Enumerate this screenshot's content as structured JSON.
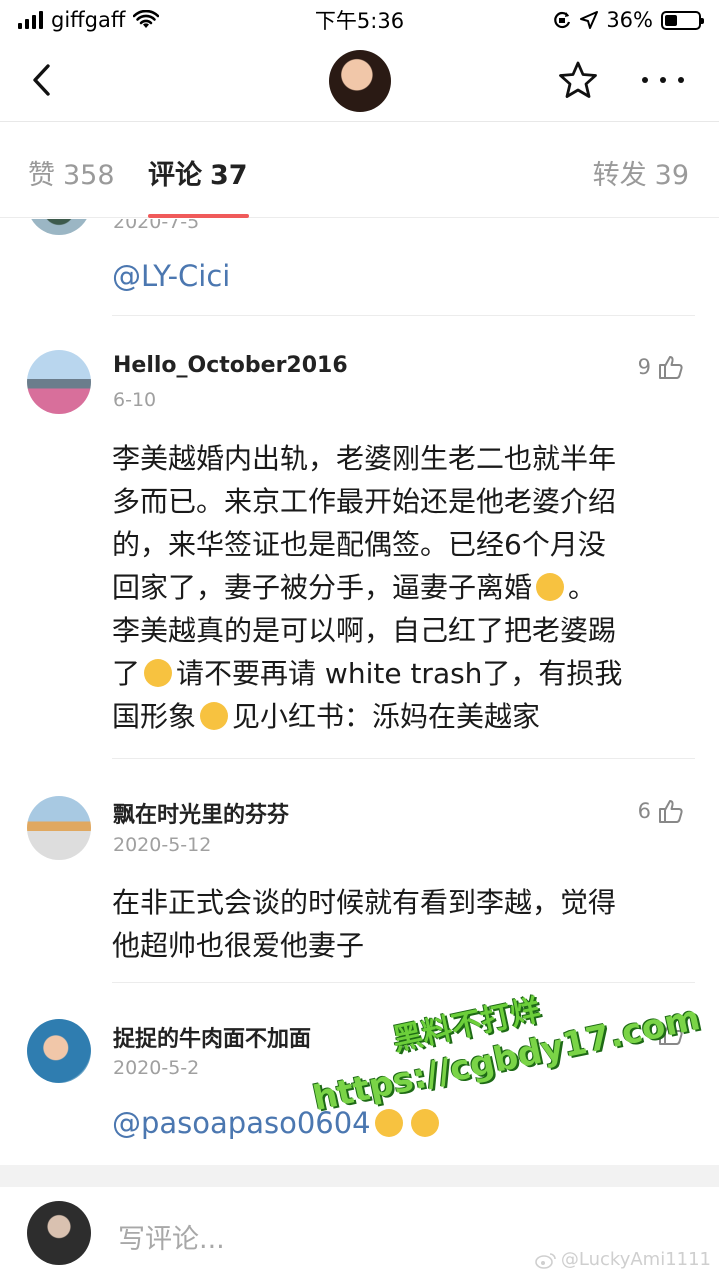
{
  "status_bar": {
    "carrier": "giffgaff",
    "time": "下午5:36",
    "battery": "36%"
  },
  "tabs": {
    "likes": {
      "label": "赞",
      "count": "358"
    },
    "comments": {
      "label": "评论",
      "count": "37"
    },
    "reposts": {
      "label": "转发",
      "count": "39"
    }
  },
  "comments": [
    {
      "date": "2020-7-5",
      "text": "@LY-Cici"
    },
    {
      "name": "Hello_October2016",
      "date": "6-10",
      "likes": "9",
      "text_lines": [
        "李美越婚内出轨，老婆刚生老二也就半年",
        "多而已。来京工作最开始还是他老婆介绍",
        "的，来华签证也是配偶签。已经6个月没",
        "回家了，妻子被分手，逼妻子离婚",
        "。",
        "李美越真的是可以啊，自己红了把老婆踢",
        "了",
        "请不要再请 white trash了，有损我",
        "国形象",
        "见小红书：泺妈在美越家"
      ]
    },
    {
      "name": "飘在时光里的芬芬",
      "date": "2020-5-12",
      "likes": "6",
      "text_lines": [
        "在非正式会谈的时候就有看到李越，觉得",
        "他超帅也很爱他妻子"
      ]
    },
    {
      "name": "捉捉的牛肉面不加面",
      "date": "2020-5-2",
      "likes": "",
      "text": "@pasoapaso0604"
    }
  ],
  "watermark": {
    "line1": "黑料不打烊",
    "line2": "https://cgbdy17.com"
  },
  "input": {
    "placeholder": "写评论..."
  },
  "credit": "@LuckyAmi1111",
  "colors": {
    "accent": "#f05a5a",
    "mention": "#4b77b0",
    "watermark": "#6ccf3a"
  }
}
